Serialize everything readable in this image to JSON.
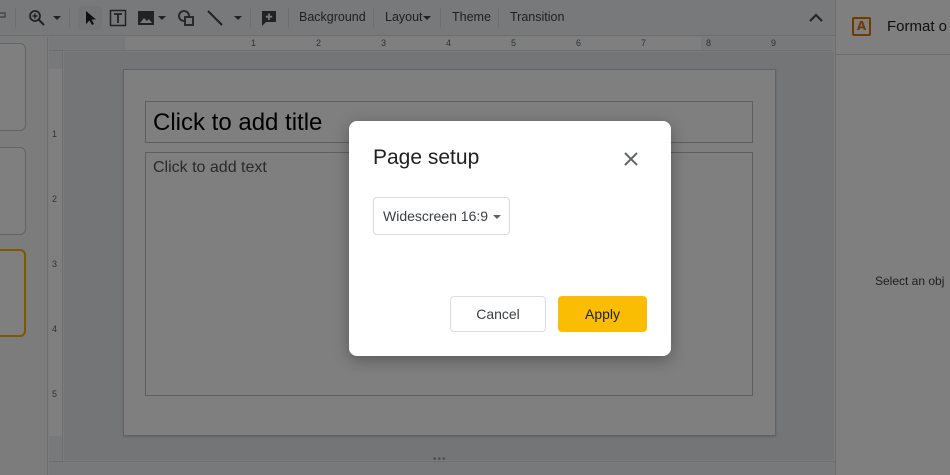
{
  "toolbar": {
    "background_label": "Background",
    "layout_label": "Layout",
    "theme_label": "Theme",
    "transition_label": "Transition"
  },
  "ruler": {
    "horizontal": [
      "1",
      "2",
      "3",
      "4",
      "5",
      "6",
      "7",
      "8",
      "9"
    ],
    "vertical": [
      "1",
      "2",
      "3",
      "4",
      "5"
    ]
  },
  "slide": {
    "title_placeholder": "Click to add title",
    "body_placeholder": "Click to add text"
  },
  "side_panel": {
    "title": "Format o",
    "message": "Select an obj"
  },
  "dialog": {
    "title": "Page setup",
    "size_value": "Widescreen 16:9",
    "cancel_label": "Cancel",
    "apply_label": "Apply"
  },
  "colors": {
    "accent": "#fbbc04",
    "overlay": "rgba(0,0,0,0.5)",
    "selected_thumb_border": "#f4b400"
  }
}
